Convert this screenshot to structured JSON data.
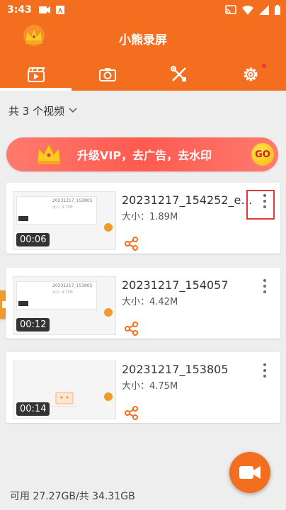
{
  "status_bar": {
    "time": "3:43"
  },
  "app": {
    "title": "小熊录屏"
  },
  "tabs": [
    {
      "name": "video",
      "icon": "video-clapper-icon"
    },
    {
      "name": "screenshot",
      "icon": "camera-icon"
    },
    {
      "name": "tools",
      "icon": "tools-icon"
    },
    {
      "name": "settings",
      "icon": "gear-icon"
    }
  ],
  "filter": {
    "label": "共 3 个视频"
  },
  "banner": {
    "text": "升级VIP，去广告，去水印",
    "go": "GO"
  },
  "videos": [
    {
      "name": "20231217_154252_edit...",
      "size": "大小：1.89M",
      "duration": "00:06",
      "thumb_title": "20231217_153805",
      "thumb_size": "大小: 4.75M"
    },
    {
      "name": "20231217_154057",
      "size": "大小：4.42M",
      "duration": "00:12",
      "thumb_title": "20231217_153805",
      "thumb_size": "大小: 4.75M"
    },
    {
      "name": "20231217_153805",
      "size": "大小：4.75M",
      "duration": "00:14"
    }
  ],
  "footer": {
    "storage": "可用 27.27GB/共 34.31GB"
  },
  "colors": {
    "primary": "#f36e1e",
    "accent": "#f39a2e",
    "banner": "#ff5a50",
    "highlight": "#e53935"
  }
}
